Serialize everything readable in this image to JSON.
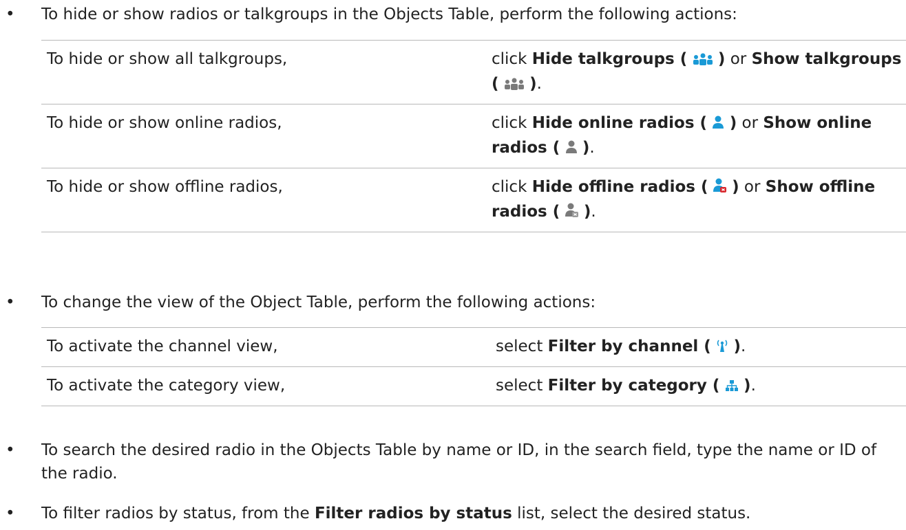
{
  "bullets": {
    "b1": "To hide or show radios or talkgroups in the Objects Table, perform the following actions:",
    "b2": "To change the view of the Object Table, perform the following actions:",
    "b3": "To search the desired radio in the Objects Table by name or ID, in the search field, type the name or ID of the radio.",
    "b4_pre": "To filter radios by status, from the ",
    "b4_bold": "Filter radios by status",
    "b4_post": " list, select the desired status."
  },
  "table1": [
    {
      "left": "To hide or show all talkgroups,",
      "click": "click ",
      "bold1": "Hide talkgroups (",
      "close1": ")",
      "or": " or ",
      "bold2": "Show talkgroups (",
      "close2": ")",
      "end": ".",
      "icon1": "talkgroups-active-icon",
      "icon2": "talkgroups-inactive-icon"
    },
    {
      "left": "To hide or show online radios,",
      "click": "click ",
      "bold1": "Hide online radios (",
      "close1": ")",
      "or": " or ",
      "bold2": "Show online radios (",
      "close2": ")",
      "end": ".",
      "icon1": "online-radio-active-icon",
      "icon2": "online-radio-inactive-icon"
    },
    {
      "left": "To hide or show offline radios,",
      "click": "click ",
      "bold1": "Hide offline radios (",
      "close1": ")",
      "or": " or ",
      "bold2": "Show offline radios (",
      "close2": ")",
      "end": ".",
      "icon1": "offline-radio-active-icon",
      "icon2": "offline-radio-inactive-icon"
    }
  ],
  "table2": [
    {
      "left": "To activate the channel view,",
      "select": "select ",
      "bold": "Filter by channel (",
      "close": ")",
      "end": ".",
      "icon": "channel-antenna-icon"
    },
    {
      "left": "To activate the category view,",
      "select": "select ",
      "bold": "Filter by category (",
      "close": ")",
      "end": ".",
      "icon": "category-hierarchy-icon"
    }
  ],
  "colors": {
    "accent": "#1a9ad6",
    "inactive": "#7a7a7a",
    "offline_badge": "#d9262c",
    "text": "#222222",
    "rule": "#b8b8b8"
  }
}
